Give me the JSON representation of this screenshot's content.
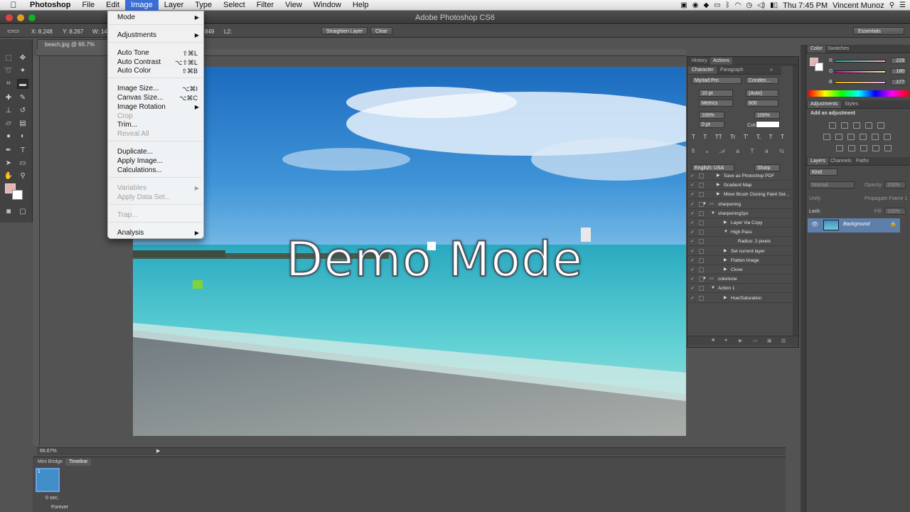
{
  "menubar": {
    "app": "Photoshop",
    "items": [
      "File",
      "Edit",
      "Image",
      "Layer",
      "Type",
      "Select",
      "Filter",
      "View",
      "Window",
      "Help"
    ],
    "active": "Image",
    "clock": "Thu 7:45 PM",
    "user": "Vincent Munoz"
  },
  "window": {
    "title": "Adobe Photoshop CS6"
  },
  "options": {
    "x": "X: 8.248",
    "y": "Y: 8.267",
    "w": "W: 14.",
    "a": "849",
    "l": "L2:",
    "straighten": "Straighten Layer",
    "clear": "Clear",
    "workspace": "Essentials"
  },
  "document": {
    "tab": "beach.jpg @ 66.7% (RGB/8",
    "zoom": "66.67%",
    "overlay": "Demo Mode"
  },
  "image_menu": {
    "items": [
      {
        "label": "Mode",
        "submenu": true
      },
      {
        "label": "Adjustments",
        "submenu": true
      },
      {
        "label": "Auto Tone",
        "shortcut": "⇧⌘L"
      },
      {
        "label": "Auto Contrast",
        "shortcut": "⌥⇧⌘L"
      },
      {
        "label": "Auto Color",
        "shortcut": "⇧⌘B"
      },
      {
        "label": "Image Size...",
        "shortcut": "⌥⌘I"
      },
      {
        "label": "Canvas Size...",
        "shortcut": "⌥⌘C"
      },
      {
        "label": "Image Rotation",
        "submenu": true
      },
      {
        "label": "Crop",
        "disabled": true
      },
      {
        "label": "Trim..."
      },
      {
        "label": "Reveal All",
        "disabled": true
      },
      {
        "label": "Duplicate..."
      },
      {
        "label": "Apply Image..."
      },
      {
        "label": "Calculations..."
      },
      {
        "label": "Variables",
        "submenu": true,
        "disabled": true
      },
      {
        "label": "Apply Data Set...",
        "disabled": true
      },
      {
        "label": "Trap...",
        "disabled": true
      },
      {
        "label": "Analysis",
        "submenu": true
      }
    ]
  },
  "mid_panel": {
    "top_tabs": [
      "History",
      "Actions"
    ],
    "tabs": [
      "Character",
      "Paragraph"
    ],
    "font": "Myriad Pro",
    "style": "Conden...",
    "size": "10 pt",
    "leading": "(Auto)",
    "kerning": "Metrics",
    "tracking": "600",
    "vscale": "100%",
    "hscale": "100%",
    "baseline": "0 pt",
    "color_label": "Color:",
    "language": "English: USA",
    "aa": "Sharp",
    "type_buttons": [
      "T",
      "T",
      "TT",
      "Tr",
      "T'",
      "T,",
      "T",
      "T"
    ],
    "actions": [
      {
        "label": "Save as Photoshop PDF",
        "level": 2
      },
      {
        "label": "Gradient Map",
        "level": 2
      },
      {
        "label": "Mixer Brush Cloning Paint Set...",
        "level": 2
      },
      {
        "label": "sharpening",
        "level": 0,
        "folder": true
      },
      {
        "label": "sharpening2px",
        "level": 1
      },
      {
        "label": "Layer Via Copy",
        "level": 3
      },
      {
        "label": "High Pass",
        "level": 3
      },
      {
        "label": "Radius: 2 pixels",
        "level": 4
      },
      {
        "label": "Set current layer",
        "level": 3
      },
      {
        "label": "Flatten Image",
        "level": 3
      },
      {
        "label": "Close",
        "level": 3
      },
      {
        "label": "colortone",
        "level": 0,
        "folder": true
      },
      {
        "label": "Action 1",
        "level": 1
      },
      {
        "label": "Hue/Saturation",
        "level": 3
      }
    ]
  },
  "right_panel": {
    "color_tabs": [
      "Color",
      "Swatches"
    ],
    "r": "229",
    "g": "180",
    "b": "177",
    "adj_tabs": [
      "Adjustments",
      "Styles"
    ],
    "adj_title": "Add an adjustment",
    "layer_tabs": [
      "Layers",
      "Channels",
      "Paths"
    ],
    "kind": "Kind",
    "blend": "Normal",
    "opacity_label": "Opacity:",
    "opacity": "100%",
    "unify": "Unify:",
    "propagate": "Propagate Frame 1",
    "lock": "Lock:",
    "fill_label": "Fill:",
    "fill": "100%",
    "layer_name": "Background",
    "accent": "#e5b4b1"
  },
  "bottom": {
    "tabs": [
      "Mini Bridge",
      "Timeline"
    ],
    "frame_no": "1",
    "frame_time": "0 sec.",
    "loop": "Forever"
  }
}
